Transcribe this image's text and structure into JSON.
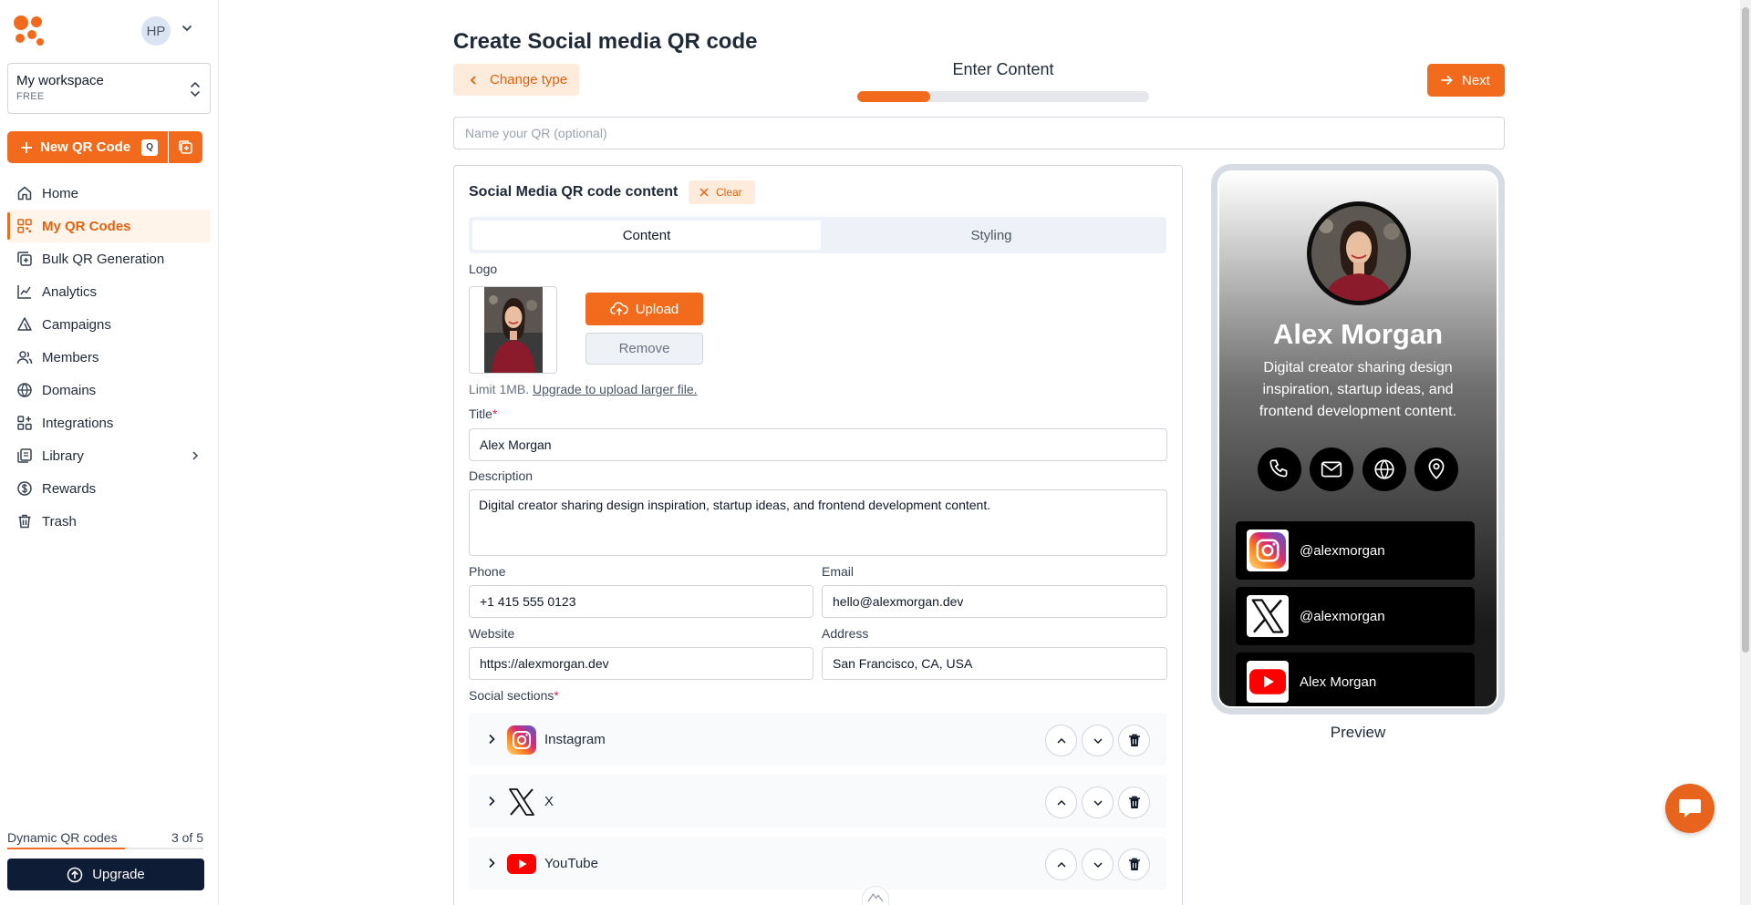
{
  "sidebar": {
    "user_initials": "HP",
    "workspace": {
      "name": "My workspace",
      "plan": "FREE"
    },
    "new_qr_label": "New QR Code",
    "new_qr_shortcut": "Q",
    "nav": [
      {
        "label": "Home",
        "icon": "home-icon"
      },
      {
        "label": "My QR Codes",
        "icon": "qr-grid-icon",
        "active": true
      },
      {
        "label": "Bulk QR Generation",
        "icon": "bulk-add-icon"
      },
      {
        "label": "Analytics",
        "icon": "analytics-icon"
      },
      {
        "label": "Campaigns",
        "icon": "campaign-icon"
      },
      {
        "label": "Members",
        "icon": "members-icon"
      },
      {
        "label": "Domains",
        "icon": "globe-icon"
      },
      {
        "label": "Integrations",
        "icon": "integrations-icon"
      },
      {
        "label": "Library",
        "icon": "library-icon"
      },
      {
        "label": "Rewards",
        "icon": "dollar-icon"
      },
      {
        "label": "Trash",
        "icon": "trash-icon"
      }
    ],
    "dynamic_label": "Dynamic QR codes",
    "dynamic_count": "3 of 5",
    "dynamic_fraction": 0.6,
    "upgrade_label": "Upgrade"
  },
  "header": {
    "title": "Create Social media QR code",
    "change_type_label": "Change type",
    "step_label": "Enter Content",
    "step_progress": 0.25,
    "next_label": "Next",
    "name_placeholder": "Name your QR (optional)"
  },
  "form": {
    "card_title": "Social Media QR code content",
    "clear_label": "Clear",
    "tabs": [
      "Content",
      "Styling"
    ],
    "logo_label": "Logo",
    "upload_label": "Upload",
    "remove_label": "Remove",
    "limit_text": "Limit 1MB.",
    "upgrade_link": "Upgrade to upload larger file.",
    "title_label": "Title",
    "title_value": "Alex Morgan",
    "description_label": "Description",
    "description_value": "Digital creator sharing design inspiration, startup ideas, and frontend development content.",
    "phone_label": "Phone",
    "phone_value": "+1 415 555 0123",
    "email_label": "Email",
    "email_value": "hello@alexmorgan.dev",
    "website_label": "Website",
    "website_value": "https://alexmorgan.dev",
    "address_label": "Address",
    "address_value": "San Francisco, CA, USA",
    "social_label": "Social sections",
    "socials": [
      {
        "name": "Instagram",
        "icon": "instagram-icon"
      },
      {
        "name": "X",
        "icon": "x-icon"
      },
      {
        "name": "YouTube",
        "icon": "youtube-icon"
      }
    ]
  },
  "preview": {
    "name": "Alex Morgan",
    "description": "Digital creator sharing design inspiration, startup ideas, and frontend development content.",
    "links": [
      {
        "text": "@alexmorgan",
        "icon": "instagram-icon"
      },
      {
        "text": "@alexmorgan",
        "icon": "x-icon"
      },
      {
        "text": "Alex Morgan",
        "icon": "youtube-icon"
      }
    ],
    "label": "Preview"
  },
  "colors": {
    "accent": "#f26b1d",
    "dark": "#0f1c36"
  }
}
